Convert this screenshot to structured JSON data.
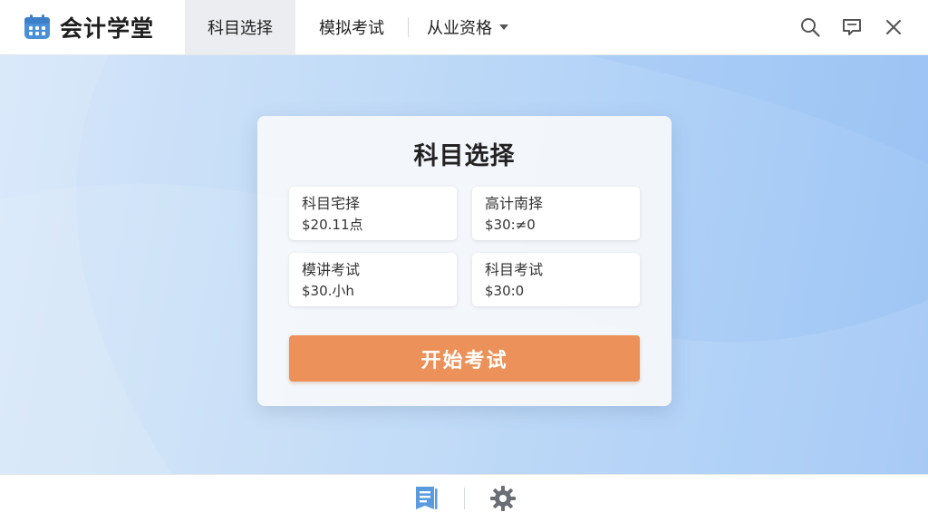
{
  "app": {
    "name": "会计学堂",
    "icon": "calendar-icon"
  },
  "nav": {
    "tabs": [
      {
        "label": "科目选择",
        "active": true
      },
      {
        "label": "模拟考试",
        "active": false
      },
      {
        "label": "从业资格",
        "active": false,
        "has_dropdown": true
      }
    ]
  },
  "top_actions": [
    "search-icon",
    "message-icon",
    "close-icon"
  ],
  "card": {
    "title": "科目选择",
    "options": [
      {
        "label": "科目宅择",
        "price": "$20.11点"
      },
      {
        "label": "高计南择",
        "price": "$30:≠0"
      },
      {
        "label": "模讲考试",
        "price": "$30.小h"
      },
      {
        "label": "科目考试",
        "price": "$30:0"
      }
    ],
    "start_button": "开始考试"
  },
  "bottom_bar": {
    "icons": [
      "book-icon",
      "settings-gear-icon"
    ]
  },
  "colors": {
    "accent_orange": "#ec9159",
    "brand_blue": "#4a90d9",
    "background_blue": "#aed0f7"
  }
}
